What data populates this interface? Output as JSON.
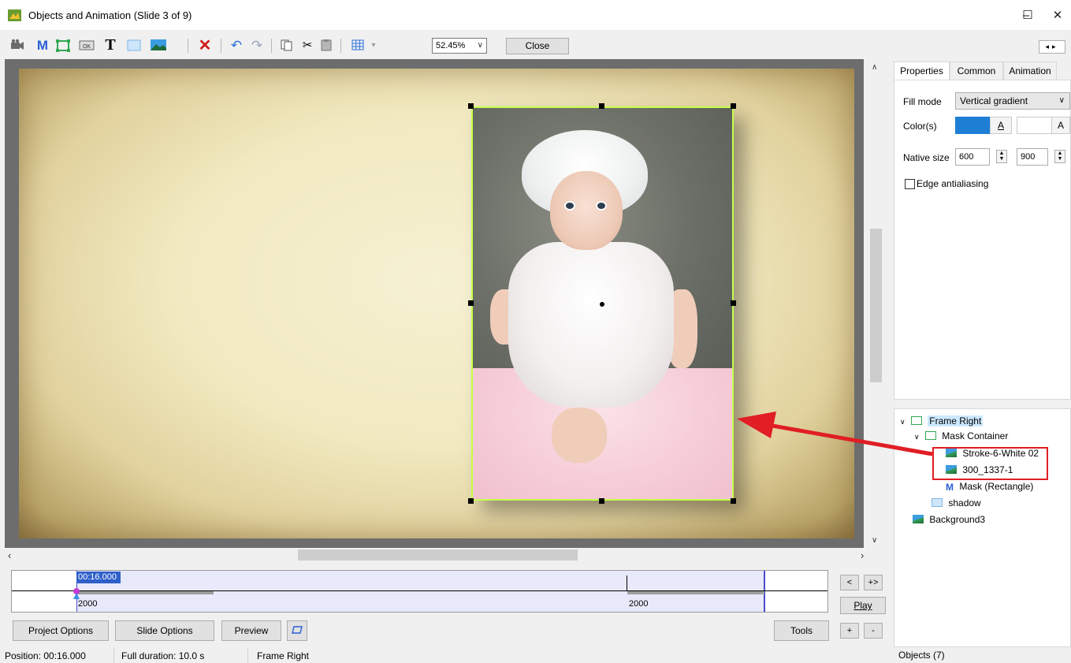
{
  "window": {
    "title": "Objects and Animation  (Slide 3 of 9)",
    "minimize": "–",
    "maximize": "☐",
    "close": "✕"
  },
  "toolbar": {
    "zoom_value": "52.45%",
    "close_label": "Close",
    "nav_arrows": "◂▸"
  },
  "timeline": {
    "marker_time": "00:16.000",
    "left_value": "2000",
    "right_value": "2000",
    "prev_label": "<",
    "jump_label": "+>",
    "play_label": "Play",
    "plus_label": "+",
    "minus_label": "-"
  },
  "bottom_buttons": {
    "project_options": "Project Options",
    "slide_options": "Slide Options",
    "preview": "Preview",
    "tools": "Tools"
  },
  "status": {
    "position": "Position:  00:16.000",
    "duration": "Full duration:  10.0 s",
    "selected": "Frame Right",
    "objects": "Objects (7)"
  },
  "tabs": [
    {
      "label": "Properties",
      "active": true
    },
    {
      "label": "Common",
      "active": false
    },
    {
      "label": "Animation",
      "active": false
    }
  ],
  "properties": {
    "fill_mode_label": "Fill mode",
    "fill_mode_value": "Vertical gradient",
    "colors_label": "Color(s)",
    "color_a": "A",
    "color_1": "#1e7fd5",
    "color_2": "#ffffff",
    "native_size_label": "Native size",
    "native_width": "600",
    "native_height": "900",
    "edge_antialiasing_label": "Edge antialiasing",
    "edge_antialiasing_checked": false
  },
  "tree": [
    {
      "label": "Frame Right",
      "icon": "frame-icon",
      "expanded": true,
      "selected": true
    },
    {
      "label": "Mask Container",
      "icon": "frame-icon",
      "expanded": true
    },
    {
      "label": "Stroke-6-White 02",
      "icon": "image-icon"
    },
    {
      "label": "300_1337-1",
      "icon": "image-icon"
    },
    {
      "label": "Mask (Rectangle)",
      "icon": "mask-icon"
    },
    {
      "label": "shadow",
      "icon": "rectangle-icon"
    },
    {
      "label": "Background3",
      "icon": "image-icon"
    }
  ],
  "colors": {
    "accent": "#2f60c9",
    "selection_border": "#c6ff4a",
    "annotation_red": "#e01e24"
  }
}
